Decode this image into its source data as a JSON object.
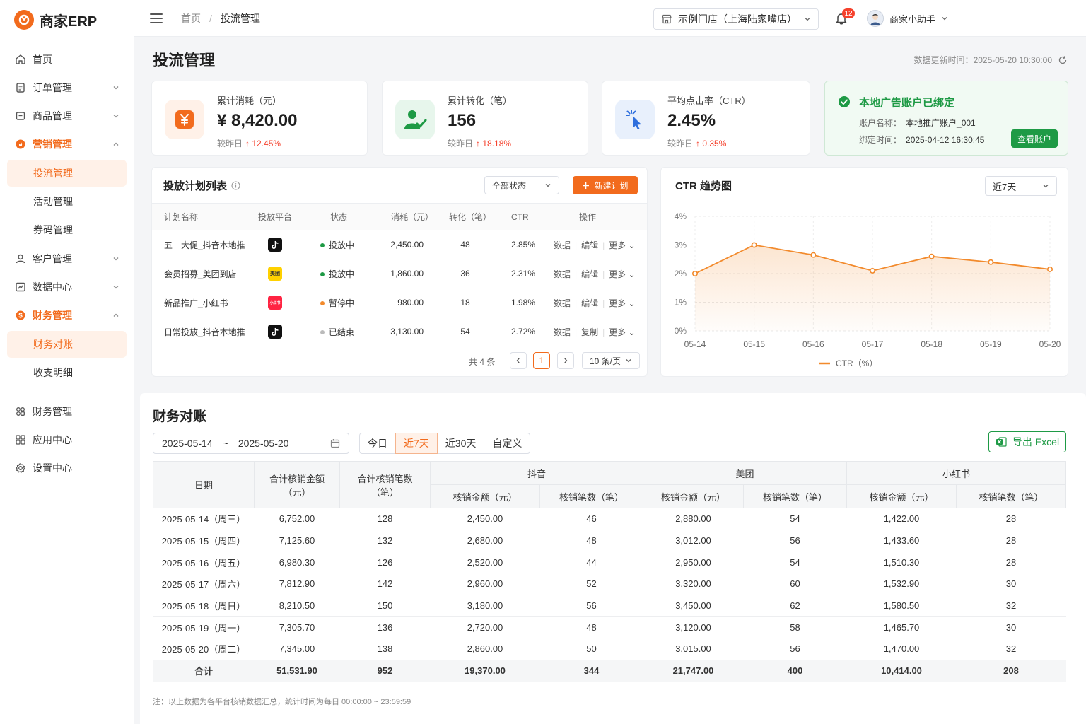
{
  "app": {
    "name": "商家ERP"
  },
  "sidebar": {
    "items": [
      {
        "label": "首页"
      },
      {
        "label": "订单管理"
      },
      {
        "label": "商品管理"
      },
      {
        "label": "营销管理"
      },
      {
        "label": "客户管理"
      },
      {
        "label": "数据中心"
      },
      {
        "label": "财务管理"
      },
      {
        "label": "财务管理"
      },
      {
        "label": "应用中心"
      },
      {
        "label": "设置中心"
      }
    ],
    "marketing_sub": [
      "投流管理",
      "活动管理",
      "券码管理"
    ],
    "finance_sub": [
      "财务对账",
      "收支明细"
    ]
  },
  "header": {
    "breadcrumb": {
      "home": "首页",
      "current": "投流管理"
    },
    "store": "示例门店（上海陆家嘴店）",
    "notifications": "12",
    "user": "商家小助手"
  },
  "page": {
    "title": "投流管理",
    "update_label": "数据更新时间：",
    "update_time": "2025-05-20 10:30:00"
  },
  "stats": [
    {
      "label": "累计消耗（元）",
      "value": "¥ 8,420.00",
      "compare": "较昨日",
      "delta": "↑ 12.45%",
      "icon": "yuan-icon"
    },
    {
      "label": "累计转化（笔）",
      "value": "156",
      "compare": "较昨日",
      "delta": "↑ 18.18%",
      "icon": "user-check-icon"
    },
    {
      "label": "平均点击率（CTR）",
      "value": "2.45%",
      "compare": "较昨日",
      "delta": "↑ 0.35%",
      "icon": "cursor-click-icon"
    }
  ],
  "ad_account": {
    "title": "本地广告账户已绑定",
    "name_label": "账户名称：",
    "name": "本地推广账户_001",
    "time_label": "绑定时间：",
    "time": "2025-04-12 16:30:45",
    "button": "查看账户"
  },
  "plans": {
    "title": "投放计划列表",
    "status_filter": "全部状态",
    "new_button": "新建计划",
    "columns": [
      "计划名称",
      "投放平台",
      "状态",
      "消耗（元）",
      "转化（笔）",
      "CTR",
      "操作"
    ],
    "rows": [
      {
        "name": "五一大促_抖音本地推",
        "platform": "douyin",
        "platform_label": "",
        "status": "投放中",
        "status_color": "#1e9a45",
        "cost": "2,450.00",
        "conv": "48",
        "ctr": "2.85%",
        "ops": [
          "数据",
          "编辑",
          "更多"
        ]
      },
      {
        "name": "会员招募_美团到店",
        "platform": "meituan",
        "platform_label": "美团",
        "status": "投放中",
        "status_color": "#1e9a45",
        "cost": "1,860.00",
        "conv": "36",
        "ctr": "2.31%",
        "ops": [
          "数据",
          "编辑",
          "更多"
        ]
      },
      {
        "name": "新品推广_小红书",
        "platform": "xiaohongshu",
        "platform_label": "小红书",
        "status": "暂停中",
        "status_color": "#f28a2c",
        "cost": "980.00",
        "conv": "18",
        "ctr": "1.98%",
        "ops": [
          "数据",
          "编辑",
          "更多"
        ]
      },
      {
        "name": "日常投放_抖音本地推",
        "platform": "douyin",
        "platform_label": "",
        "status": "已结束",
        "status_color": "#bbbbbb",
        "cost": "3,130.00",
        "conv": "54",
        "ctr": "2.72%",
        "ops": [
          "数据",
          "复制",
          "更多"
        ]
      }
    ],
    "total": "共 4 条",
    "page": "1",
    "page_size": "10 条/页"
  },
  "chart_panel": {
    "title": "CTR 趋势图",
    "range": "近7天"
  },
  "chart_data": {
    "type": "area",
    "title": "CTR 趋势图",
    "x": [
      "05-14",
      "05-15",
      "05-16",
      "05-17",
      "05-18",
      "05-19",
      "05-20"
    ],
    "series": [
      {
        "name": "CTR（%）",
        "values": [
          2.0,
          3.0,
          2.65,
          2.1,
          2.6,
          2.4,
          2.15
        ]
      }
    ],
    "yticks": [
      "4%",
      "3%",
      "2%",
      "1%",
      "0%"
    ],
    "ylim": [
      0,
      4
    ],
    "grid": true,
    "legend": "bottom",
    "color": "#f28a2c"
  },
  "finance": {
    "title": "财务对账",
    "date_start": "2025-05-14",
    "date_sep": "~",
    "date_end": "2025-05-20",
    "quick": [
      "今日",
      "近7天",
      "近30天",
      "自定义"
    ],
    "export": "导出 Excel",
    "head": {
      "date": "日期",
      "total_amount": "合计核销金额（元）",
      "total_count": "合计核销笔数（笔）",
      "groups": [
        "抖音",
        "美团",
        "小红书"
      ],
      "amount": "核销金额（元）",
      "count": "核销笔数（笔）"
    },
    "rows": [
      [
        "2025-05-14（周三）",
        "6,752.00",
        "128",
        "2,450.00",
        "46",
        "2,880.00",
        "54",
        "1,422.00",
        "28"
      ],
      [
        "2025-05-15（周四）",
        "7,125.60",
        "132",
        "2,680.00",
        "48",
        "3,012.00",
        "56",
        "1,433.60",
        "28"
      ],
      [
        "2025-05-16（周五）",
        "6,980.30",
        "126",
        "2,520.00",
        "44",
        "2,950.00",
        "54",
        "1,510.30",
        "28"
      ],
      [
        "2025-05-17（周六）",
        "7,812.90",
        "142",
        "2,960.00",
        "52",
        "3,320.00",
        "60",
        "1,532.90",
        "30"
      ],
      [
        "2025-05-18（周日）",
        "8,210.50",
        "150",
        "3,180.00",
        "56",
        "3,450.00",
        "62",
        "1,580.50",
        "32"
      ],
      [
        "2025-05-19（周一）",
        "7,305.70",
        "136",
        "2,720.00",
        "48",
        "3,120.00",
        "58",
        "1,465.70",
        "30"
      ],
      [
        "2025-05-20（周二）",
        "7,345.00",
        "138",
        "2,860.00",
        "50",
        "3,015.00",
        "56",
        "1,470.00",
        "32"
      ]
    ],
    "total": [
      "合计",
      "51,531.90",
      "952",
      "19,370.00",
      "344",
      "21,747.00",
      "400",
      "10,414.00",
      "208"
    ],
    "note": "注：以上数据为各平台核销数据汇总，统计时间为每日 00:00:00 ~ 23:59:59"
  },
  "colors": {
    "accent": "#f26b1d",
    "success": "#1e9a45",
    "danger": "#f5412c"
  }
}
